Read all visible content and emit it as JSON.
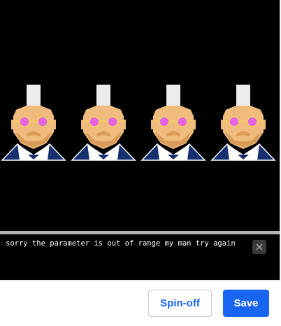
{
  "console": {
    "message": "sorry the parameter is out of range my man try again",
    "close_icon": "close-icon"
  },
  "canvas": {
    "background": "#000000",
    "figure_count": 4
  },
  "colors": {
    "hair": "#ececec",
    "skin": "#efbc7e",
    "beard": "#d99b58",
    "glasses_lens": "#e663e6",
    "glasses_frame": "#f3ce5e",
    "jacket": "#152f6f",
    "shirt": "#ffffff",
    "accent": "#1865f2"
  },
  "footer": {
    "spinoff_label": "Spin-off",
    "save_label": "Save"
  }
}
